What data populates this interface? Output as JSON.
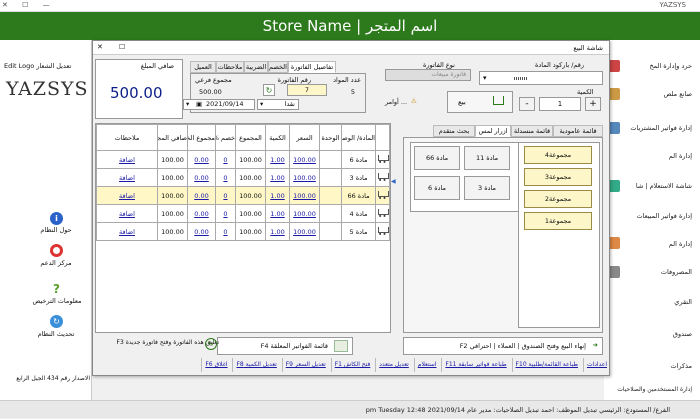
{
  "window": {
    "title": "YAZSYS",
    "header": "Store Name | اسم المتجر"
  },
  "left_panel": {
    "edit_logo": "Edit Logo تعديل الشعار",
    "logo": "YAZSYS",
    "items": [
      {
        "label": "حول النظام",
        "icon": "info-icon"
      },
      {
        "label": "مركز الدعم",
        "icon": "lifebuoy-icon"
      },
      {
        "label": "معلومات الترخيص",
        "icon": "license-icon"
      },
      {
        "label": "تحديث النظام",
        "icon": "update-icon"
      }
    ],
    "version": "الاصدار رقم 434 الجيل الرابع"
  },
  "right_panel": {
    "items": [
      "حرد وإدارة المخ",
      "صانع ملص",
      "إدارة فواتير المشتريات",
      "إدارة الم",
      "شاشة الاستعلام | شا",
      "إدارة فواتير المبيعات",
      "إدارة الم",
      "المصروفات",
      "التقري",
      "صندوق",
      "مذكرات",
      "إدارة المستخدمين والصلاحيات"
    ]
  },
  "dialog": {
    "title": "شاشة البيع",
    "barcode_label": "رقم/ باركود المادة",
    "invoice_type_label": "نوع الفاتورة",
    "invoice_type_value": "فاتورة مبيعات",
    "quantity_label": "الكمية",
    "quantity_value": "1",
    "sell_button": "بيع",
    "options_label": "أوامر ...",
    "net_amount_label": "صافي المبلغ",
    "net_amount": "500.00",
    "tabs_top": [
      "تفاصيل الفاتورة",
      "الخصم",
      "الضريبة",
      "ملاحظات",
      "العميل"
    ],
    "items_count_label": "عدد المواد",
    "items_count": "5",
    "invoice_no_label": "رقم الفاتورة",
    "invoice_no": "7",
    "subtotal_label": "مجموع فرعي",
    "subtotal": "500.00",
    "date": "2021/09/14",
    "payment": "نقدا",
    "browse_tabs": [
      "قائمة عامودية",
      "قائمة منسدلة",
      "ازرار لمس",
      "بحث متقدم"
    ],
    "groups": [
      "مجموعة4",
      "مجموعة3",
      "مجموعة2",
      "مجموعة1"
    ],
    "items": [
      "مادة 11",
      "مادة 66",
      "مادة 3",
      "مادة 6"
    ],
    "grid_headers": [
      "",
      "المادة/ الوصف",
      "الوحدة",
      "السعر",
      "الكمية",
      "المجموع",
      "خصم %",
      "مجموع الخصم",
      "صافي المجموع",
      "ملاحظات"
    ],
    "rows": [
      {
        "name": "مادة 6",
        "price": "100.00",
        "qty": "1.00",
        "total": "100.00",
        "disc": "0",
        "disc_total": "0.00",
        "net": "100.00",
        "note": "اضافة"
      },
      {
        "name": "مادة 3",
        "price": "100.00",
        "qty": "1.00",
        "total": "100.00",
        "disc": "0",
        "disc_total": "0.00",
        "net": "100.00",
        "note": "اضافة"
      },
      {
        "name": "مادة 66",
        "price": "100.00",
        "qty": "1.00",
        "total": "100.00",
        "disc": "0",
        "disc_total": "0.00",
        "net": "100.00",
        "note": "اضافة"
      },
      {
        "name": "مادة 4",
        "price": "100.00",
        "qty": "1.00",
        "total": "100.00",
        "disc": "0",
        "disc_total": "0.00",
        "net": "100.00",
        "note": "اضافة"
      },
      {
        "name": "مادة 5",
        "price": "100.00",
        "qty": "1.00",
        "total": "100.00",
        "disc": "0",
        "disc_total": "0.00",
        "net": "100.00",
        "note": "اضافة"
      }
    ],
    "finish_button": "إنهاء البيع وفتح الصندوق | العملاء | احترافي F2",
    "pending_button": "قائمة الفواتير المعلقة F4",
    "hold_button": "تعليق هذه الفاتورة وفتح فاتورة جديدة F3",
    "actions": [
      "اعدادات",
      "طباعة القائمة/طلبية F10",
      "طباعة فواتير سابقة F11",
      "استعلام",
      "تعديل متعدد",
      "فتح الكاش F1",
      "تعديل السعر F9",
      "تعديل الكمية F8",
      "اغلاق F6"
    ]
  },
  "status": "الفرع/ المستودع: الرئيسي تبديل الموظف: احمد تبديل الصلاحيات: مدير عام 2021/09/14 12:48 pm Tuesday"
}
